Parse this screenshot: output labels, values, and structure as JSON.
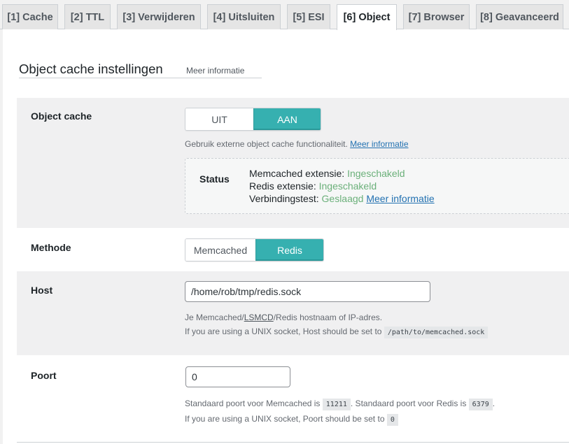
{
  "tabs": [
    {
      "label": "[1] Cache"
    },
    {
      "label": "[2] TTL"
    },
    {
      "label": "[3] Verwijderen"
    },
    {
      "label": "[4] Uitsluiten"
    },
    {
      "label": "[5] ESI"
    },
    {
      "label": "[6] Object"
    },
    {
      "label": "[7] Browser"
    },
    {
      "label": "[8] Geavanceerd"
    }
  ],
  "active_tab": "[6] Object",
  "section": {
    "title": "Object cache instellingen",
    "more_info": "Meer informatie"
  },
  "object_cache": {
    "label": "Object cache",
    "off_label": "UIT",
    "on_label": "AAN",
    "selected": "AAN",
    "description": "Gebruik externe object cache functionaliteit.",
    "more_info": "Meer informatie",
    "status": {
      "label": "Status",
      "memcached_text": "Memcached extensie:",
      "memcached_value": "Ingeschakeld",
      "redis_text": "Redis extensie:",
      "redis_value": "Ingeschakeld",
      "test_text": "Verbindingstest:",
      "test_value": "Geslaagd",
      "more_info": "Meer informatie"
    }
  },
  "method": {
    "label": "Methode",
    "option_a": "Memcached",
    "option_b": "Redis",
    "selected": "Redis"
  },
  "host": {
    "label": "Host",
    "value": "/home/rob/tmp/redis.sock",
    "desc_before": "Je Memcached/",
    "desc_link": "LSMCD",
    "desc_after": "/Redis hostnaam of IP-adres.",
    "socket_note": "If you are using a UNIX socket, Host should be set to",
    "socket_value": "/path/to/memcached.sock"
  },
  "port": {
    "label": "Poort",
    "value": "0",
    "desc_1": "Standaard poort voor Memcached is",
    "memcached_port": "11211",
    "desc_2": ". Standaard poort voor Redis is",
    "redis_port": "6379",
    "desc_3": ".",
    "socket_note": "If you are using a UNIX socket, Poort should be set to",
    "socket_value": "0"
  },
  "colors": {
    "accent": "#36b0b0",
    "success": "#6bb07a",
    "link": "#2271b1"
  }
}
